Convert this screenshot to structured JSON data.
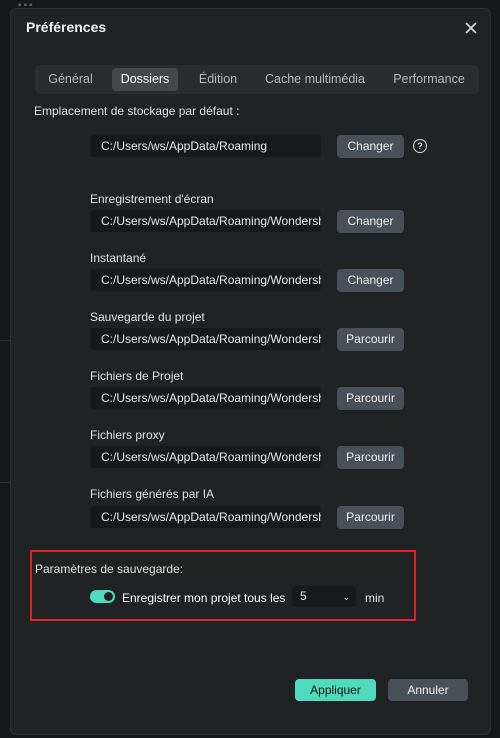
{
  "dialog": {
    "title": "Préférences"
  },
  "tabs": [
    {
      "label": "Général"
    },
    {
      "label": "Dossiers"
    },
    {
      "label": "Édition"
    },
    {
      "label": "Cache multimédia"
    },
    {
      "label": "Performance"
    }
  ],
  "active_tab": "Dossiers",
  "default_storage": {
    "label": "Emplacement de stockage par défaut :",
    "path": "C:/Users/ws/AppData/Roaming",
    "button": "Changer"
  },
  "folders": [
    {
      "label": "Enregistrement d'écran",
      "path": "C:/Users/ws/AppData/Roaming/Wondershare",
      "button": "Changer"
    },
    {
      "label": "Instantané",
      "path": "C:/Users/ws/AppData/Roaming/Wondershare",
      "button": "Changer"
    },
    {
      "label": "Sauvegarde du projet",
      "path": "C:/Users/ws/AppData/Roaming/Wondershare",
      "button": "Parcourir"
    },
    {
      "label": "Fichiers de Projet",
      "path": "C:/Users/ws/AppData/Roaming/Wondershare",
      "button": "Parcourir"
    },
    {
      "label": "Fichiers proxy",
      "path": "C:/Users/ws/AppData/Roaming/Wondershare",
      "button": "Parcourir"
    },
    {
      "label": "Fichiers générés par IA",
      "path": "C:/Users/ws/AppData/Roaming/Wondershare",
      "button": "Parcourir"
    }
  ],
  "backup": {
    "title": "Paramètres de sauvegarde:",
    "toggle_on": true,
    "toggle_label": "Enregistrer mon projet tous les",
    "interval": "5",
    "unit": "min"
  },
  "footer": {
    "apply": "Appliquer",
    "cancel": "Annuler"
  },
  "colors": {
    "accent": "#4fd9bd",
    "highlight_border": "#d9262b",
    "button_bg": "#4a5058"
  },
  "icons": {
    "close": "close-icon",
    "help": "help-icon",
    "chevron": "chevron-down-icon",
    "toggle": "toggle-switch"
  }
}
